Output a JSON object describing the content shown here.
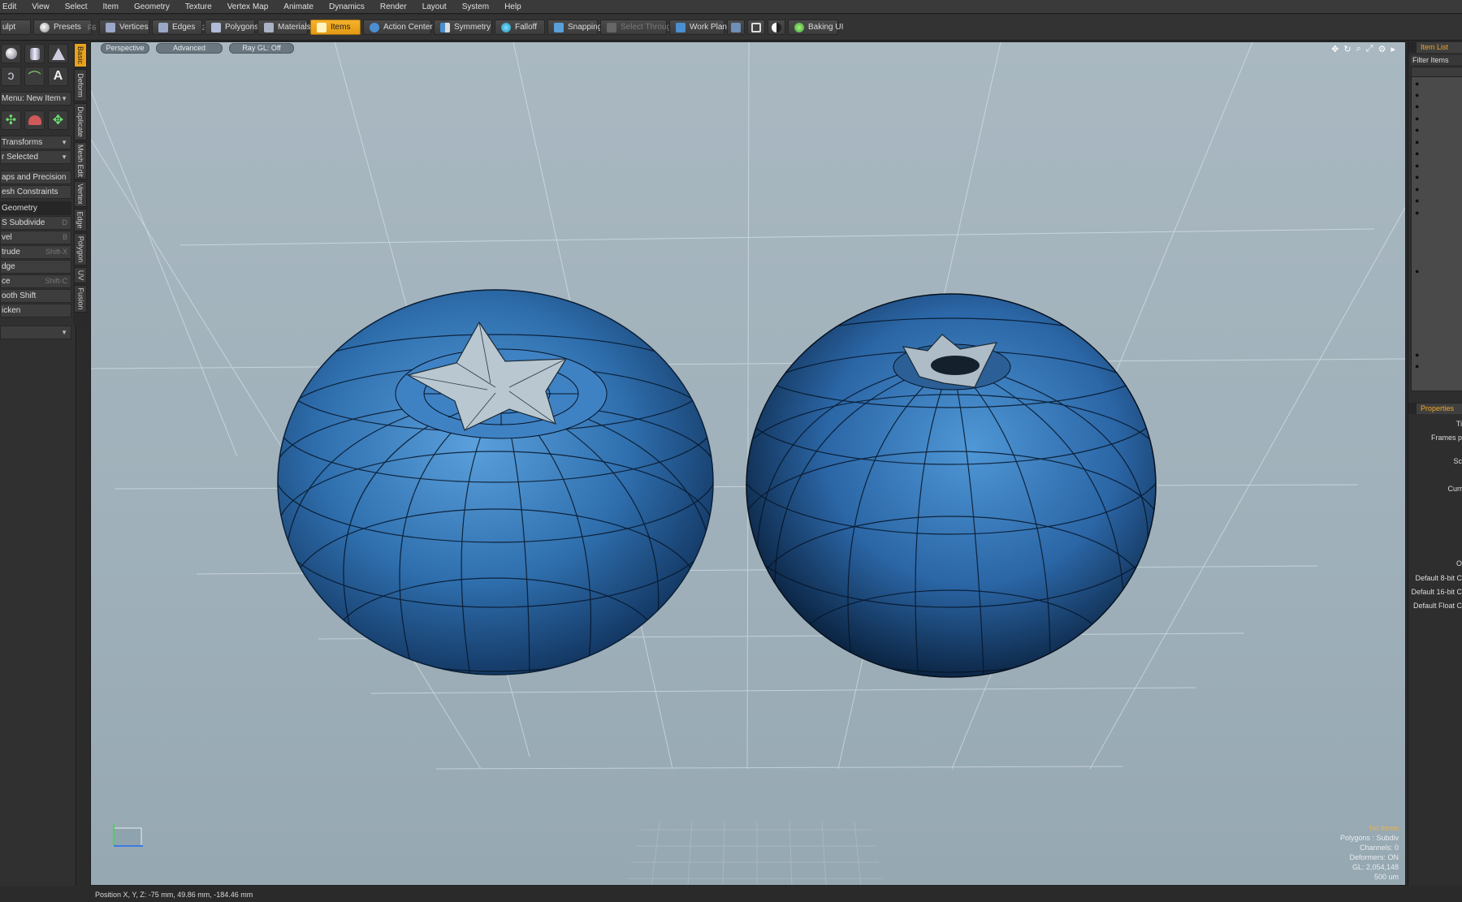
{
  "menu": [
    "Edit",
    "View",
    "Select",
    "Item",
    "Geometry",
    "Texture",
    "Vertex Map",
    "Animate",
    "Dynamics",
    "Render",
    "Layout",
    "System",
    "Help"
  ],
  "toolbar": {
    "sculpt_label": "ulpt",
    "presets_label": "Presets",
    "presets_key": "F6",
    "buttons": [
      {
        "label": "Vertices",
        "key": "1",
        "icon": "vertices-icon"
      },
      {
        "label": "Edges",
        "key": "2",
        "icon": "edges-icon"
      },
      {
        "label": "Polygons",
        "key": "",
        "icon": "polygons-icon"
      },
      {
        "label": "Materials",
        "key": "",
        "icon": "materials-icon"
      },
      {
        "label": "Items",
        "key": "",
        "icon": "items-icon"
      },
      {
        "label": "Action Center",
        "key": "",
        "icon": "action-center-icon"
      },
      {
        "label": "Symmetry",
        "key": "",
        "icon": "symmetry-icon"
      },
      {
        "label": "Falloff",
        "key": "",
        "icon": "falloff-icon"
      },
      {
        "label": "Snapping",
        "key": "",
        "icon": "snapping-icon"
      },
      {
        "label": "Select Through",
        "key": "",
        "icon": "select-through-icon"
      },
      {
        "label": "Work Plane",
        "key": "",
        "icon": "work-plane-icon"
      },
      {
        "label": "Baking UI",
        "key": "",
        "icon": "baking-icon"
      }
    ],
    "active_button": "Items",
    "accent_color": "#f0a823"
  },
  "left_panel": {
    "menu_new_item": "Menu: New Item",
    "transforms": "Transforms",
    "selected": "r Selected",
    "snaps": "aps and Precision",
    "constraints": "esh Constraints",
    "geometry_header": "Geometry",
    "tools": [
      {
        "label": "S Subdivide",
        "hotkey": "D"
      },
      {
        "label": "vel",
        "hotkey": "B"
      },
      {
        "label": "trude",
        "hotkey": "Shift-X"
      },
      {
        "label": "dge",
        "hotkey": ""
      },
      {
        "label": "ce",
        "hotkey": "Shift-C"
      },
      {
        "label": "ooth Shift",
        "hotkey": ""
      },
      {
        "label": "icken",
        "hotkey": ""
      }
    ],
    "vertical_tabs": [
      "Basic",
      "Deform",
      "Duplicate",
      "Mesh Edit",
      "Vertex",
      "Edge",
      "Polygon",
      "UV",
      "Fusion"
    ]
  },
  "viewport": {
    "tabs": [
      "Perspective",
      "Advanced",
      "Ray GL: Off"
    ],
    "stats": [
      "No Items",
      "Polygons : Subdiv",
      "Channels: 0",
      "Deformers: ON",
      "GL: 2,054,148",
      "500 um"
    ],
    "object_color": "#2f6fae"
  },
  "right_panel": {
    "item_list_tab": "Item List",
    "filter_label": "Filter Items",
    "properties_tab": "Properties",
    "properties": [
      "Ti",
      "Frames p",
      "Sc",
      "Curr",
      "O",
      "Default 8-bit C",
      "Default 16-bit C",
      "Default Float C"
    ]
  },
  "status_bar": {
    "position": "Position X, Y, Z:   -75 mm, 49.86 mm, -184.46 mm"
  }
}
